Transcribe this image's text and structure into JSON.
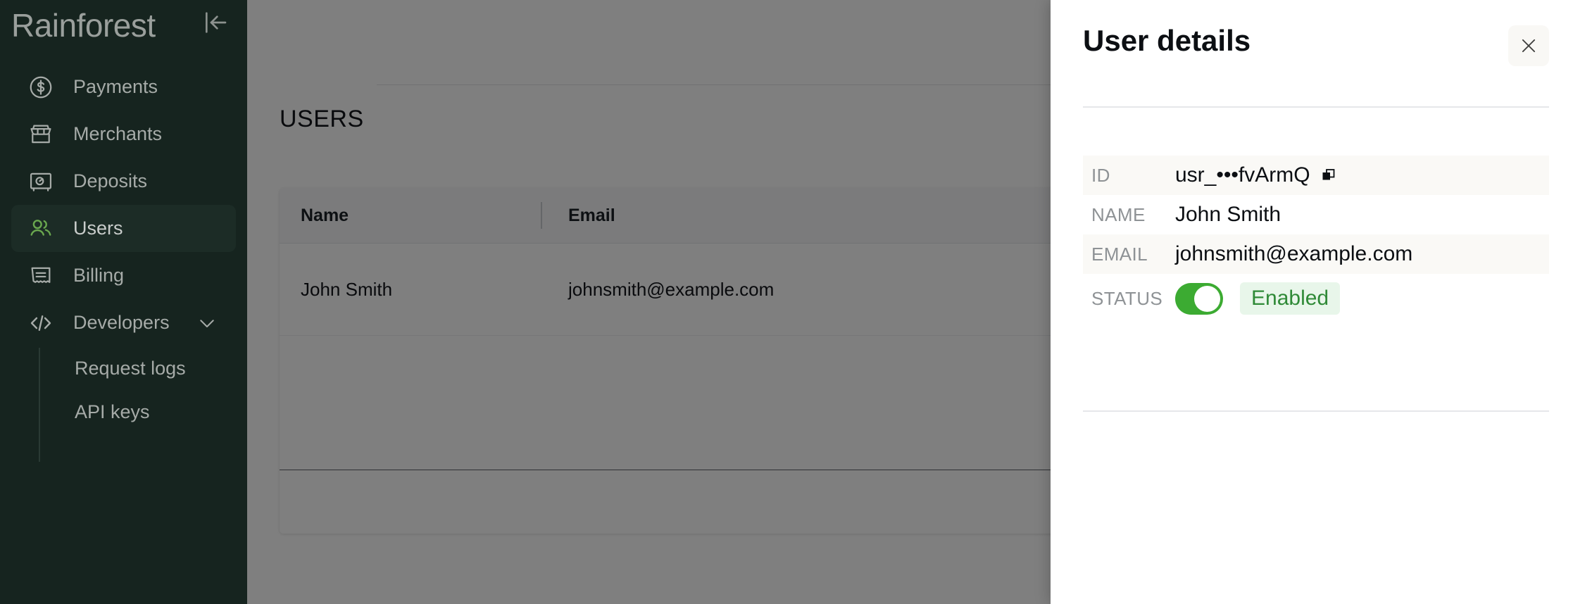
{
  "sidebar": {
    "brand": "Rainforest",
    "collapse_icon": "collapse-sidebar-icon",
    "items": [
      {
        "label": "Payments",
        "icon": "dollar-circle-icon",
        "active": false
      },
      {
        "label": "Merchants",
        "icon": "storefront-icon",
        "active": false
      },
      {
        "label": "Deposits",
        "icon": "safe-box-icon",
        "active": false
      },
      {
        "label": "Users",
        "icon": "users-icon",
        "active": true
      },
      {
        "label": "Billing",
        "icon": "receipt-icon",
        "active": false
      },
      {
        "label": "Developers",
        "icon": "code-brackets-icon",
        "active": false,
        "expandable": true,
        "expanded": true
      }
    ],
    "subitems": [
      {
        "label": "Request logs"
      },
      {
        "label": "API keys"
      }
    ],
    "colors": {
      "background": "#16241f",
      "active_background": "#1c2c26",
      "active_icon": "#6aa84f",
      "text": "#a6aba8"
    }
  },
  "main": {
    "page_title": "USERS",
    "table": {
      "columns": [
        "Name",
        "Email"
      ],
      "rows": [
        {
          "name": "John Smith",
          "email": "johnsmith@example.com"
        }
      ]
    }
  },
  "drawer": {
    "title": "User details",
    "close_icon": "close-icon",
    "fields": [
      {
        "label": "ID",
        "value": "usr_•••fvArmQ",
        "copyable": true,
        "copy_icon": "copy-icon",
        "striped": true
      },
      {
        "label": "NAME",
        "value": "John Smith",
        "copyable": false,
        "striped": false
      },
      {
        "label": "EMAIL",
        "value": "johnsmith@example.com",
        "copyable": false,
        "striped": true
      }
    ],
    "status": {
      "label": "STATUS",
      "enabled": true,
      "text": "Enabled",
      "colors": {
        "toggle_on": "#3cab32",
        "pill_background": "#e8f6ea",
        "pill_text": "#2f8a37"
      }
    }
  }
}
